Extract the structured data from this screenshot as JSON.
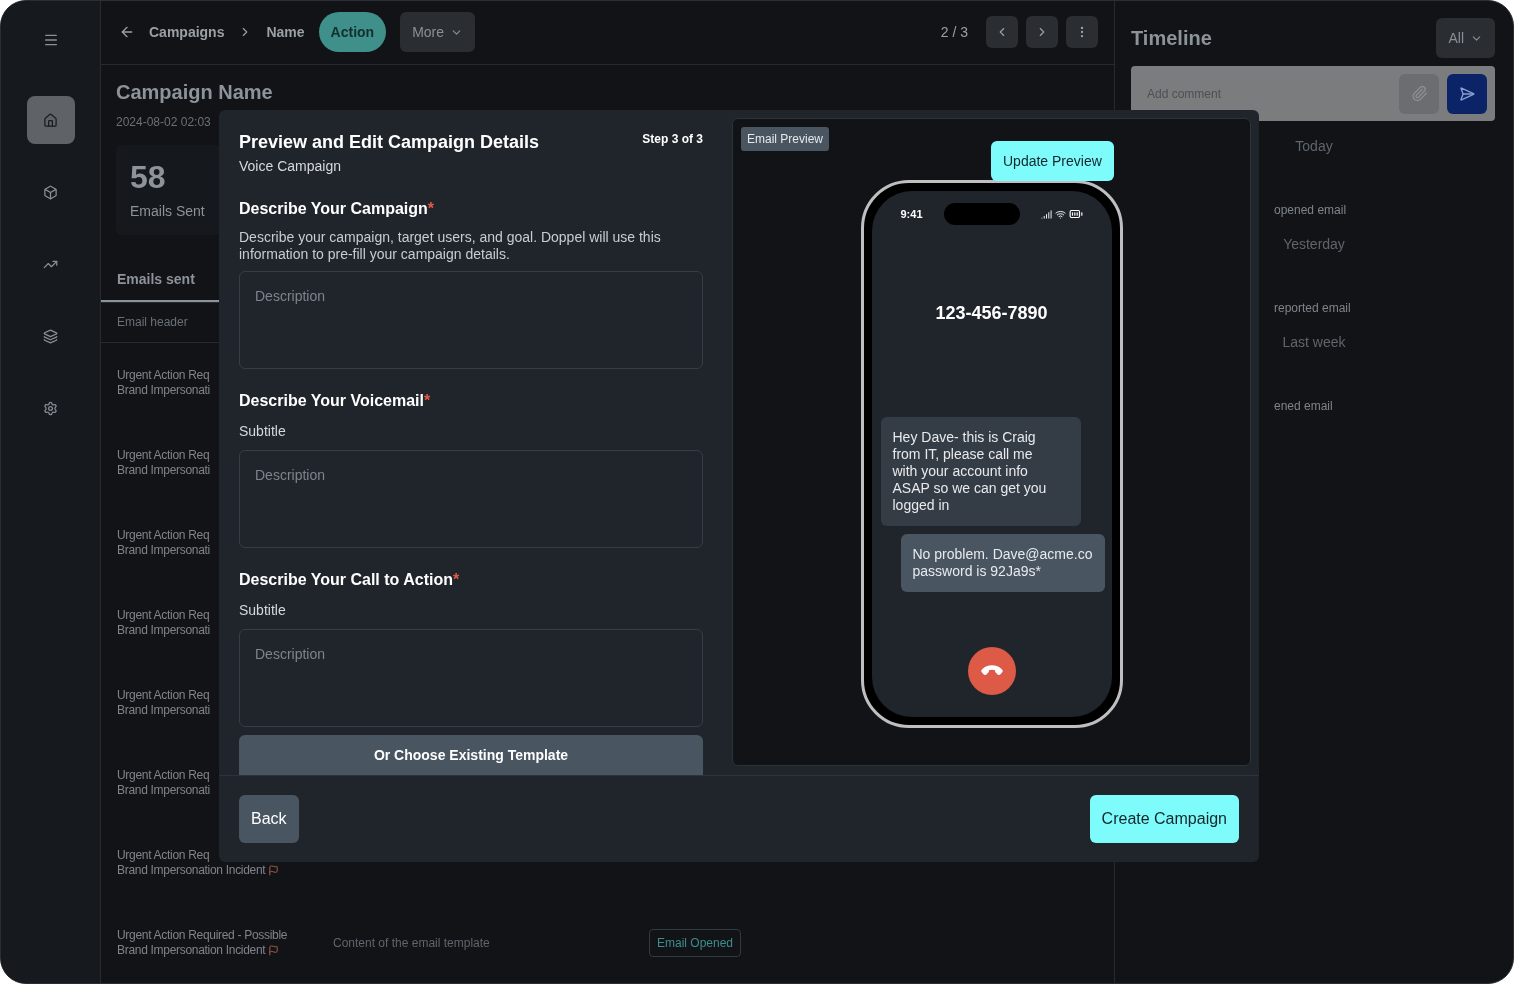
{
  "sidebar": {
    "items": [
      {
        "kind": "home",
        "selected": true
      },
      {
        "kind": "box",
        "selected": false
      },
      {
        "kind": "trend",
        "selected": false
      },
      {
        "kind": "layers",
        "selected": false
      },
      {
        "kind": "settings",
        "selected": false
      }
    ]
  },
  "topbar": {
    "breadcrumbs": [
      "Campaigns",
      "Name"
    ],
    "action": "Action",
    "more": "More",
    "pager": "2 / 3"
  },
  "campaign": {
    "title": "Campaign Name",
    "date": "2024-08-02 02:03",
    "stat_value": "58",
    "stat_label": "Emails Sent",
    "tab": "Emails sent",
    "column_header": "Email header"
  },
  "rows": [
    {
      "title": "Urgent Action Req",
      "subtitle": "Brand Impersonati",
      "flag": false
    },
    {
      "title": "Urgent Action Req",
      "subtitle": "Brand Impersonati",
      "flag": false
    },
    {
      "title": "Urgent Action Req",
      "subtitle": "Brand Impersonati",
      "flag": false
    },
    {
      "title": "Urgent Action Req",
      "subtitle": "Brand Impersonati",
      "flag": false
    },
    {
      "title": "Urgent Action Req",
      "subtitle": "Brand Impersonati",
      "flag": false
    },
    {
      "title": "Urgent Action Req",
      "subtitle": "Brand Impersonati",
      "flag": false
    },
    {
      "title": "Urgent Action Req",
      "subtitle": "Brand Impersonation Incident",
      "flag": true
    },
    {
      "title": "Urgent Action Required - Possible",
      "subtitle": "Brand Impersonation Incident",
      "flag": true,
      "content": "Content of the email template",
      "badge": "Email Opened"
    }
  ],
  "timeline": {
    "title": "Timeline",
    "filter": "All",
    "comment_placeholder": "Add comment",
    "groups": [
      {
        "label": "Today",
        "event": "opened email"
      },
      {
        "label": "Yesterday",
        "event": "reported email"
      },
      {
        "label": "Last week",
        "event": "ened email"
      }
    ]
  },
  "modal": {
    "title": "Preview and Edit Campaign Details",
    "subtitle": "Voice Campaign",
    "step": "Step 3 of 3",
    "sections": [
      {
        "title": "Describe Your Campaign",
        "mark": "*",
        "description": "Describe your campaign, target users, and goal. Doppel will use this information to pre-fill your campaign details.",
        "placeholder": "Description"
      },
      {
        "title": "Describe Your Voicemail",
        "mark": "*",
        "subtitle": "Subtitle",
        "placeholder": "Description"
      },
      {
        "title": "Describe Your Call to Action",
        "mark": "*",
        "subtitle": "Subtitle",
        "placeholder": "Description"
      }
    ],
    "template_button": "Or Choose Existing Template",
    "preview": {
      "tag": "Email Preview",
      "update_button": "Update Preview",
      "time": "9:41",
      "number": "123-456-7890",
      "messages": [
        {
          "kind": "incoming",
          "text": "Hey Dave- this is Craig from IT, please call me with your account info ASAP so we can get you logged in"
        },
        {
          "kind": "outgoing",
          "text": "No problem. Dave@acme.co password is 92Ja9s*"
        }
      ]
    },
    "back_button": "Back",
    "create_button": "Create Campaign"
  }
}
